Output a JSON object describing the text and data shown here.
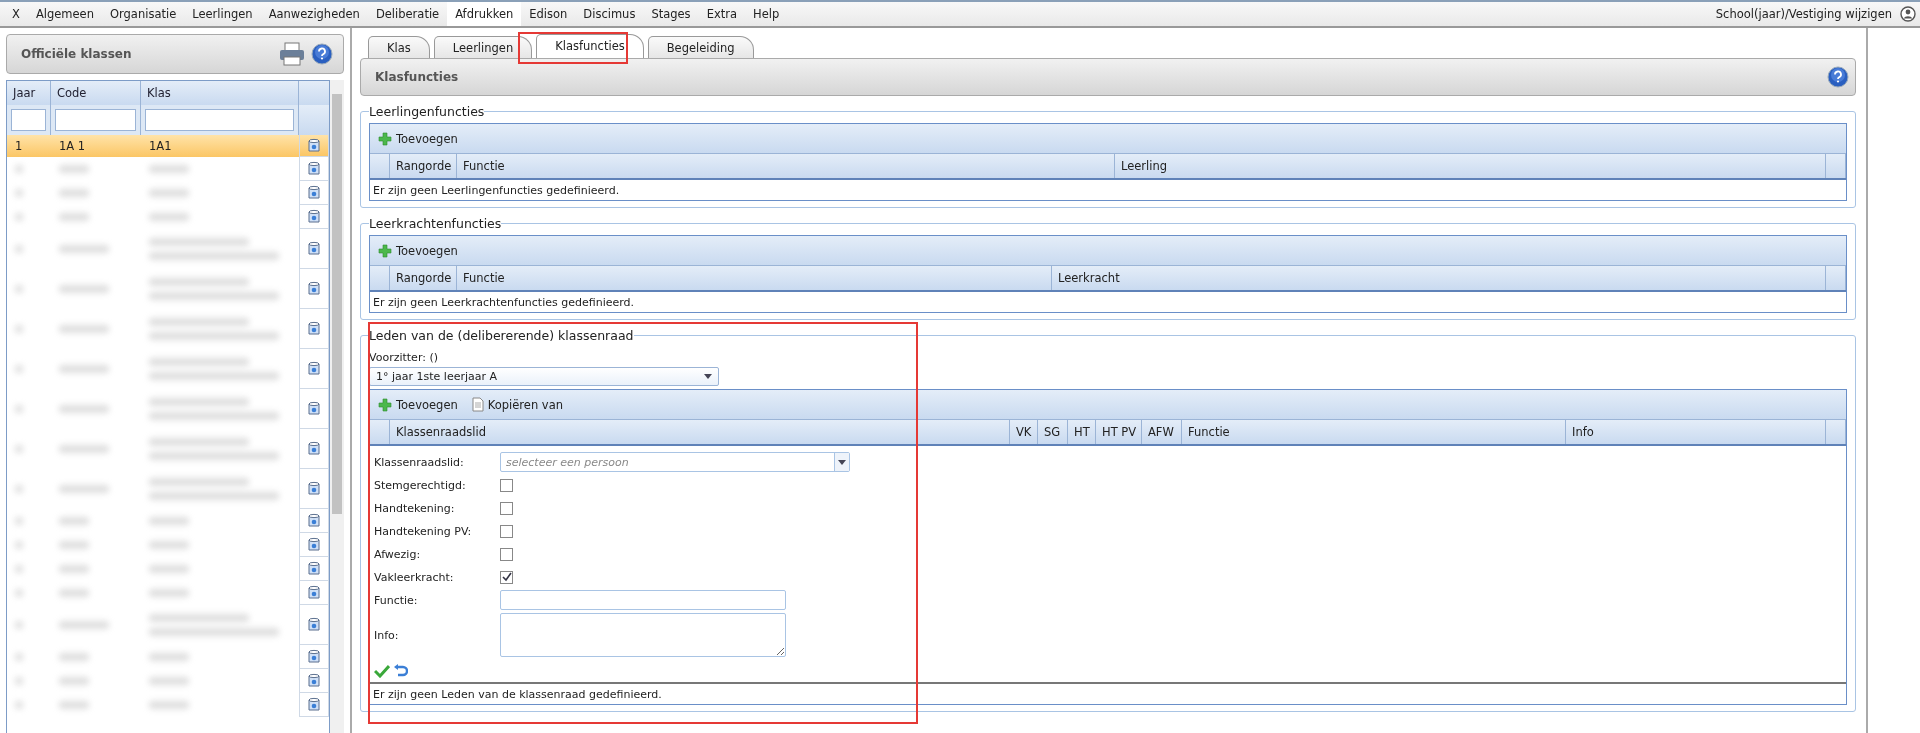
{
  "menu": {
    "items": [
      {
        "label": "X",
        "selected": false
      },
      {
        "label": "Algemeen",
        "selected": false
      },
      {
        "label": "Organisatie",
        "selected": false
      },
      {
        "label": "Leerlingen",
        "selected": false
      },
      {
        "label": "Aanwezigheden",
        "selected": false
      },
      {
        "label": "Deliberatie",
        "selected": false
      },
      {
        "label": "Afdrukken",
        "selected": true
      },
      {
        "label": "Edison",
        "selected": false
      },
      {
        "label": "Discimus",
        "selected": false
      },
      {
        "label": "Stages",
        "selected": false
      },
      {
        "label": "Extra",
        "selected": false
      },
      {
        "label": "Help",
        "selected": false
      }
    ],
    "account": "School(jaar)/Vestiging wijzigen"
  },
  "sidebar": {
    "title": "Officiële klassen",
    "columns": [
      "Jaar",
      "Code",
      "Klas"
    ],
    "rows": [
      {
        "kind": "text",
        "jaar": "1",
        "code": "1A 1",
        "klas": "1A1",
        "selected": true
      },
      {
        "kind": "redacted",
        "tall": false,
        "selected": false
      },
      {
        "kind": "redacted",
        "tall": false,
        "selected": false
      },
      {
        "kind": "redacted",
        "tall": false,
        "selected": false
      },
      {
        "kind": "redacted",
        "tall": true,
        "selected": false
      },
      {
        "kind": "redacted",
        "tall": true,
        "selected": false
      },
      {
        "kind": "redacted",
        "tall": true,
        "selected": false
      },
      {
        "kind": "redacted",
        "tall": true,
        "selected": false
      },
      {
        "kind": "redacted",
        "tall": true,
        "selected": false
      },
      {
        "kind": "redacted",
        "tall": true,
        "selected": false
      },
      {
        "kind": "redacted",
        "tall": true,
        "selected": false
      },
      {
        "kind": "redacted",
        "tall": false,
        "selected": false
      },
      {
        "kind": "redacted",
        "tall": false,
        "selected": false
      },
      {
        "kind": "redacted",
        "tall": false,
        "selected": false
      },
      {
        "kind": "redacted",
        "tall": false,
        "selected": false
      },
      {
        "kind": "redacted",
        "tall": true,
        "selected": false
      },
      {
        "kind": "redacted",
        "tall": false,
        "selected": false
      },
      {
        "kind": "redacted",
        "tall": false,
        "selected": false
      },
      {
        "kind": "redacted",
        "tall": false,
        "selected": false
      }
    ]
  },
  "tabs": [
    {
      "label": "Klas",
      "selected": false
    },
    {
      "label": "Leerlingen",
      "selected": false
    },
    {
      "label": "Klasfuncties",
      "selected": true
    },
    {
      "label": "Begeleiding",
      "selected": false
    }
  ],
  "panel": {
    "title": "Klasfuncties"
  },
  "sections": [
    {
      "title": "Leerlingenfuncties",
      "toolbar": [
        "Toevoegen"
      ],
      "columns": [
        "Rangorde",
        "Functie",
        "Leerling"
      ],
      "empty": "Er zijn geen Leerlingenfuncties gedefinieerd."
    },
    {
      "title": "Leerkrachtenfuncties",
      "toolbar": [
        "Toevoegen"
      ],
      "columns": [
        "Rangorde",
        "Functie",
        "Leerkracht"
      ],
      "empty": "Er zijn geen Leerkrachtenfuncties gedefinieerd."
    },
    {
      "title": "Leden van de (delibererende) klassenraad",
      "chair_label": "Voorzitter: ()",
      "chair_value": "1° jaar 1ste leerjaar A",
      "toolbar": [
        "Toevoegen",
        "Kopiëren van"
      ],
      "columns": [
        "Klassenraadslid",
        "VK",
        "SG",
        "HT",
        "HT PV",
        "AFW",
        "Functie",
        "Info"
      ],
      "form": [
        {
          "kind": "select",
          "label": "Klassenraadslid:",
          "placeholder": "selecteer een persoon"
        },
        {
          "kind": "checkbox",
          "label": "Stemgerechtigd:",
          "checked": false
        },
        {
          "kind": "checkbox",
          "label": "Handtekening:",
          "checked": false
        },
        {
          "kind": "checkbox",
          "label": "Handtekening PV:",
          "checked": false
        },
        {
          "kind": "checkbox",
          "label": "Afwezig:",
          "checked": false
        },
        {
          "kind": "checkbox",
          "label": "Vakleerkracht:",
          "checked": true
        },
        {
          "kind": "text",
          "label": "Functie:"
        },
        {
          "kind": "textarea",
          "label": "Info:"
        }
      ],
      "empty": "Er zijn geen Leden van de klassenraad gedefinieerd."
    }
  ]
}
